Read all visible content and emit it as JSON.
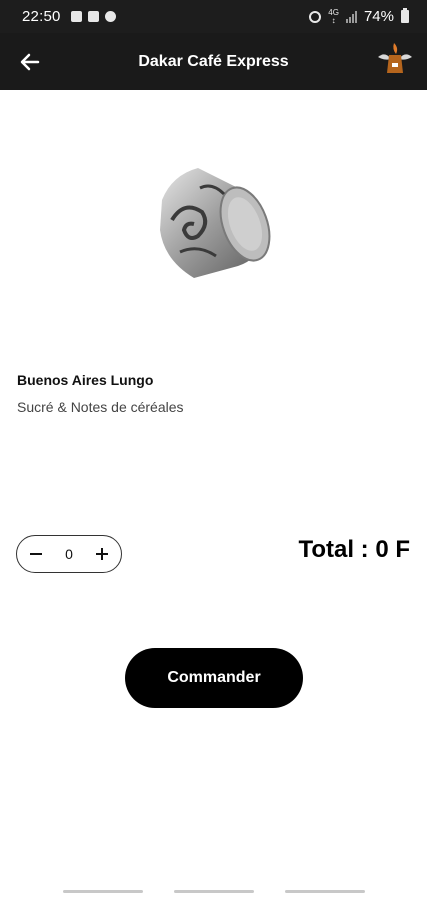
{
  "status_bar": {
    "time": "22:50",
    "network": "4G",
    "battery": "74%"
  },
  "header": {
    "title": "Dakar Café Express"
  },
  "product": {
    "name": "Buenos Aires Lungo",
    "description": "Sucré & Notes de céréales"
  },
  "order": {
    "quantity": "0",
    "total_label": "Total : 0 F",
    "button_label": "Commander"
  },
  "colors": {
    "header_bg": "#1a1a1a",
    "button_bg": "#000000",
    "accent": "#b5651d"
  }
}
